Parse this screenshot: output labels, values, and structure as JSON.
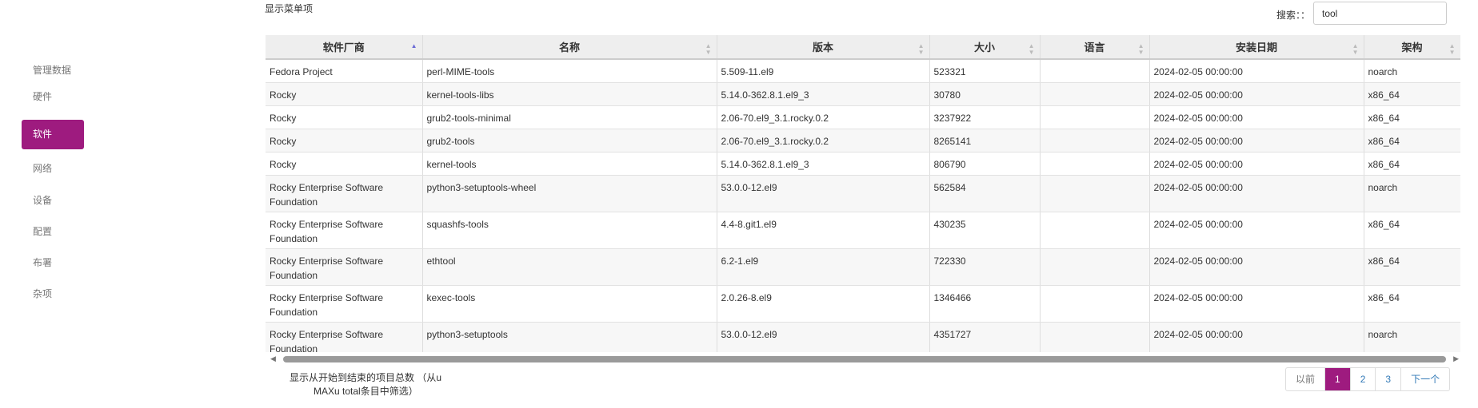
{
  "sidebar": {
    "items": [
      {
        "label": "管理数据"
      },
      {
        "label": "硬件"
      },
      {
        "label": "软件",
        "active": true
      },
      {
        "label": "网络"
      },
      {
        "label": "设备"
      },
      {
        "label": "配置"
      },
      {
        "label": "布署"
      },
      {
        "label": "杂项"
      }
    ]
  },
  "top": {
    "show_menu_label": "显示菜单项",
    "search_label": "搜索：：",
    "search_value": "tool"
  },
  "table": {
    "columns": [
      "软件厂商",
      "名称",
      "版本",
      "大小",
      "语言",
      "安装日期",
      "架构"
    ],
    "rows": [
      [
        "Fedora Project",
        "perl-MIME-tools",
        "5.509-11.el9",
        "523321",
        "",
        "2024-02-05 00:00:00",
        "noarch"
      ],
      [
        "Rocky",
        "kernel-tools-libs",
        "5.14.0-362.8.1.el9_3",
        "30780",
        "",
        "2024-02-05 00:00:00",
        "x86_64"
      ],
      [
        "Rocky",
        "grub2-tools-minimal",
        "2.06-70.el9_3.1.rocky.0.2",
        "3237922",
        "",
        "2024-02-05 00:00:00",
        "x86_64"
      ],
      [
        "Rocky",
        "grub2-tools",
        "2.06-70.el9_3.1.rocky.0.2",
        "8265141",
        "",
        "2024-02-05 00:00:00",
        "x86_64"
      ],
      [
        "Rocky",
        "kernel-tools",
        "5.14.0-362.8.1.el9_3",
        "806790",
        "",
        "2024-02-05 00:00:00",
        "x86_64"
      ],
      [
        "Rocky Enterprise Software Foundation",
        "python3-setuptools-wheel",
        "53.0.0-12.el9",
        "562584",
        "",
        "2024-02-05 00:00:00",
        "noarch"
      ],
      [
        "Rocky Enterprise Software Foundation",
        "squashfs-tools",
        "4.4-8.git1.el9",
        "430235",
        "",
        "2024-02-05 00:00:00",
        "x86_64"
      ],
      [
        "Rocky Enterprise Software Foundation",
        "ethtool",
        "6.2-1.el9",
        "722330",
        "",
        "2024-02-05 00:00:00",
        "x86_64"
      ],
      [
        "Rocky Enterprise Software Foundation",
        "kexec-tools",
        "2.0.26-8.el9",
        "1346466",
        "",
        "2024-02-05 00:00:00",
        "x86_64"
      ],
      [
        "Rocky Enterprise Software Foundation",
        "python3-setuptools",
        "53.0.0-12.el9",
        "4351727",
        "",
        "2024-02-05 00:00:00",
        "noarch"
      ]
    ]
  },
  "footer": {
    "info_line1": "显示从开始到结束的项目总数 （从u",
    "info_line2": "MAXu total条目中筛选）",
    "pagination": {
      "prev": "以前",
      "pages": [
        "1",
        "2",
        "3"
      ],
      "current": "1",
      "next": "下一个"
    }
  },
  "colors": {
    "accent": "#9e1b7f",
    "link": "#337ab7"
  }
}
